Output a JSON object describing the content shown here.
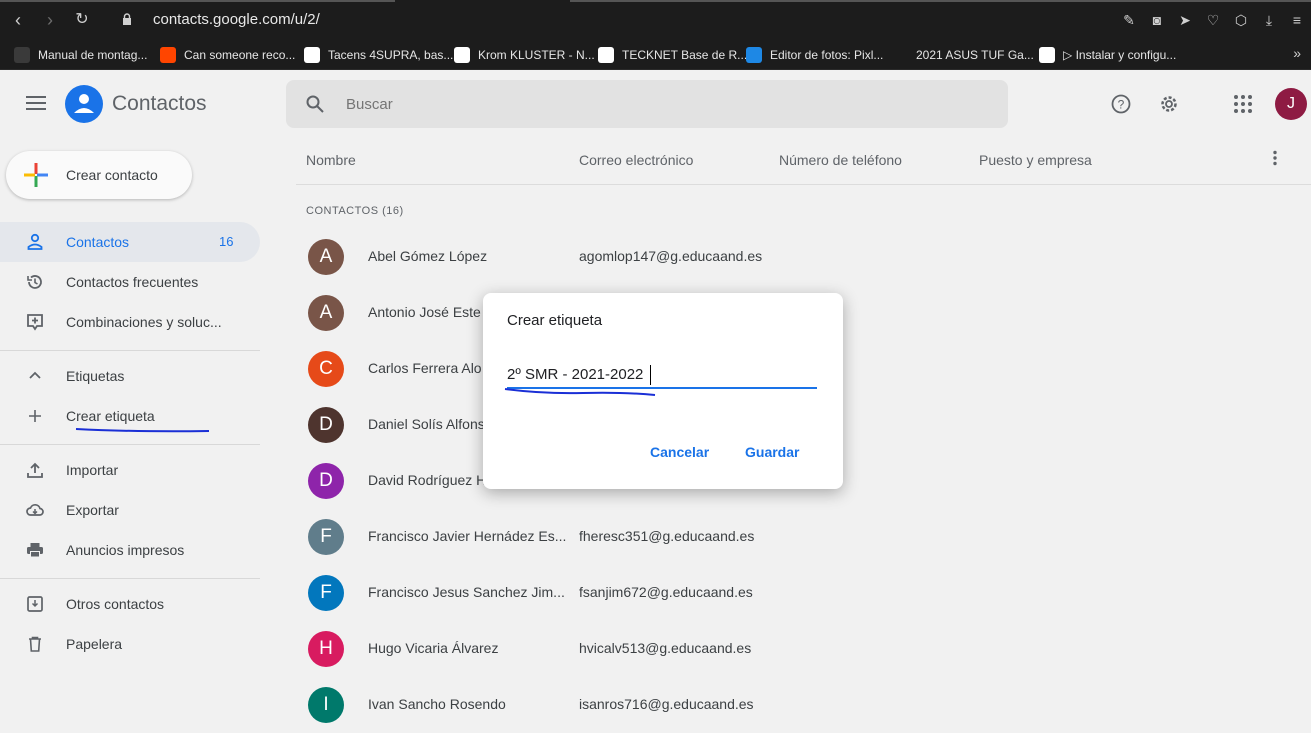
{
  "browser": {
    "url": "contacts.google.com/u/2/",
    "bookmarks": [
      {
        "label": "Manual de montag...",
        "color": "#3a3a3a",
        "icon": "wordpress-icon"
      },
      {
        "label": "Can someone reco...",
        "color": "#ff4500",
        "icon": "reddit-icon"
      },
      {
        "label": "Tacens 4SUPRA, bas...",
        "color": "#ffffff",
        "icon": "amazon-icon"
      },
      {
        "label": "Krom KLUSTER - N...",
        "color": "#ffffff",
        "icon": "amazon-icon"
      },
      {
        "label": "TECKNET Base de R...",
        "color": "#ffffff",
        "icon": "amazon-icon"
      },
      {
        "label": "Editor de fotos: Pixl...",
        "color": "#1e88e5",
        "icon": "pixlr-icon"
      },
      {
        "label": "2021 ASUS TUF Ga...",
        "color": "#1c1c1c",
        "icon": "asus-icon"
      },
      {
        "label": "▷ Instalar y configu...",
        "color": "#ffffff",
        "icon": "document-icon"
      }
    ]
  },
  "header": {
    "app_title": "Contactos",
    "search_placeholder": "Buscar",
    "avatar_letter": "J"
  },
  "sidebar": {
    "create_label": "Crear contacto",
    "items": [
      {
        "label": "Contactos",
        "count": "16"
      },
      {
        "label": "Contactos frecuentes"
      },
      {
        "label": "Combinaciones y soluc..."
      },
      {
        "label": "Etiquetas"
      },
      {
        "label": "Crear etiqueta"
      },
      {
        "label": "Importar"
      },
      {
        "label": "Exportar"
      },
      {
        "label": "Anuncios impresos"
      },
      {
        "label": "Otros contactos"
      },
      {
        "label": "Papelera"
      }
    ]
  },
  "list": {
    "columns": [
      "Nombre",
      "Correo electrónico",
      "Número de teléfono",
      "Puesto y empresa"
    ],
    "section_label": "CONTACTOS (16)",
    "rows": [
      {
        "initial": "A",
        "name": "Abel Gómez López",
        "email": "agomlop147@g.educaand.es",
        "color": "#795548"
      },
      {
        "initial": "A",
        "name": "Antonio José Este",
        "email": "",
        "color": "#795548"
      },
      {
        "initial": "C",
        "name": "Carlos Ferrera Alo",
        "email": "",
        "color": "#e64a19"
      },
      {
        "initial": "D",
        "name": "Daniel Solís Alfons",
        "email": "",
        "color": "#4e342e"
      },
      {
        "initial": "D",
        "name": "David Rodríguez H",
        "email": "",
        "color": "#8e24aa"
      },
      {
        "initial": "F",
        "name": "Francisco Javier Hernádez Es...",
        "email": "fheresc351@g.educaand.es",
        "color": "#607d8b"
      },
      {
        "initial": "F",
        "name": "Francisco Jesus Sanchez Jim...",
        "email": "fsanjim672@g.educaand.es",
        "color": "#0277bd"
      },
      {
        "initial": "H",
        "name": "Hugo Vicaria Álvarez",
        "email": "hvicalv513@g.educaand.es",
        "color": "#d81b60"
      },
      {
        "initial": "I",
        "name": "Ivan Sancho Rosendo",
        "email": "isanros716@g.educaand.es",
        "color": "#00796b"
      }
    ]
  },
  "dialog": {
    "title": "Crear etiqueta",
    "input_value": "2º SMR - 2021-2022",
    "cancel_label": "Cancelar",
    "save_label": "Guardar"
  }
}
